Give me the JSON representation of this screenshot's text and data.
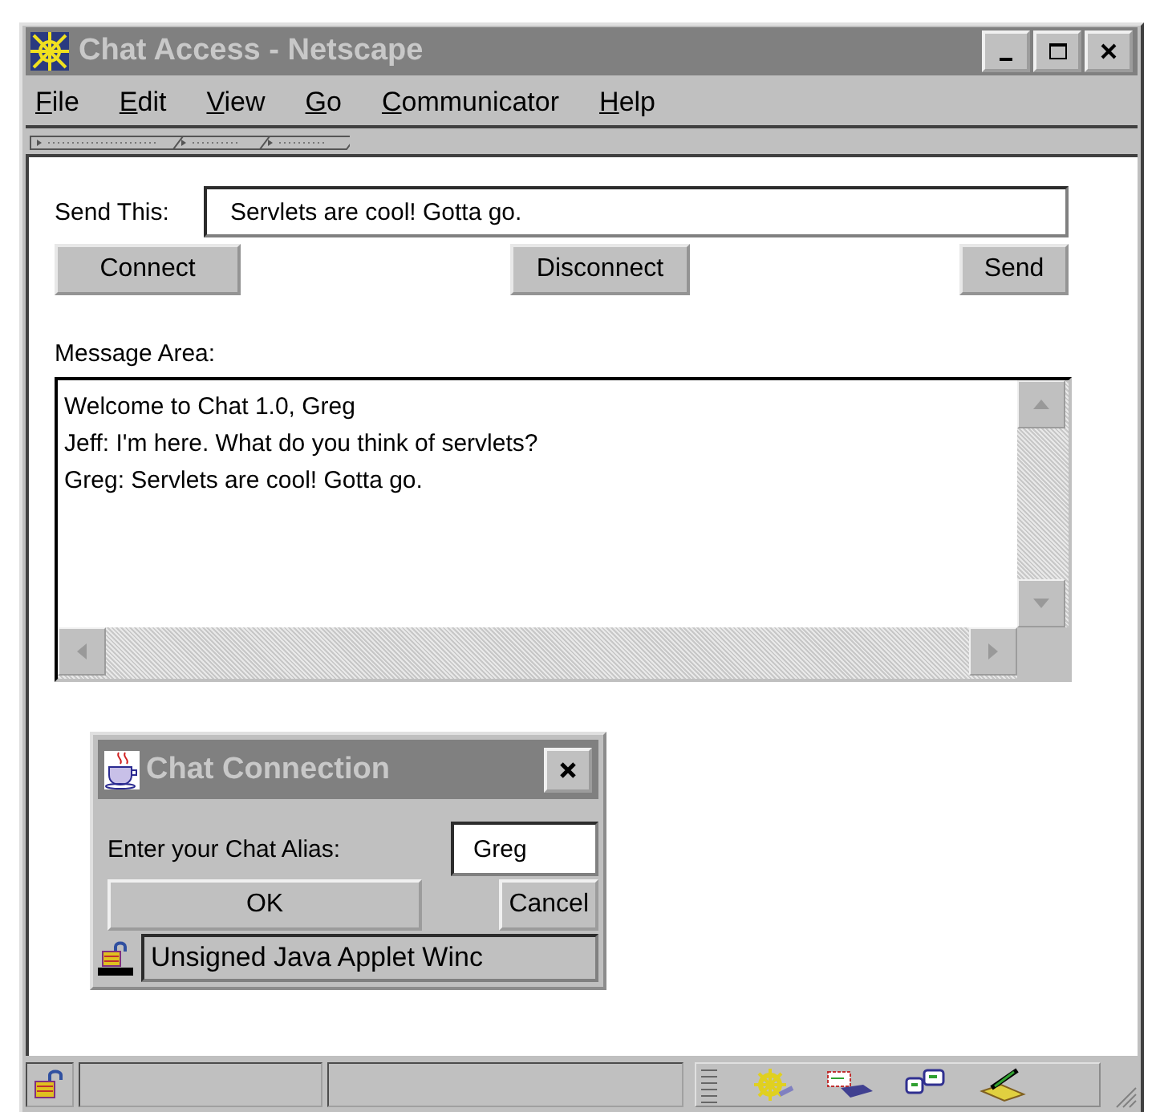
{
  "window": {
    "title": "Chat Access - Netscape"
  },
  "menu": [
    {
      "label": "File"
    },
    {
      "label": "Edit"
    },
    {
      "label": "View"
    },
    {
      "label": "Go"
    },
    {
      "label": "Communicator"
    },
    {
      "label": "Help"
    }
  ],
  "send_label": "Send This:",
  "send_field": {
    "value": "Servlets are cool! Gotta go."
  },
  "buttons": [
    {
      "label": "Connect",
      "kind": "left"
    },
    {
      "label": "Disconnect",
      "kind": "center"
    },
    {
      "label": "Send",
      "kind": "right"
    }
  ],
  "message_label": "Message Area:",
  "messages": [
    "Welcome to Chat 1.0, Greg",
    "Jeff: I'm here. What do you think of servlets?",
    "Greg: Servlets are cool! Gotta go."
  ],
  "dialog": {
    "title": "Chat Connection",
    "alias_label": "Enter your Chat Alias:",
    "alias_field": {
      "value": "Greg"
    },
    "buttons": [
      "OK",
      "Cancel"
    ],
    "status": "Unsigned Java Applet Winc"
  }
}
